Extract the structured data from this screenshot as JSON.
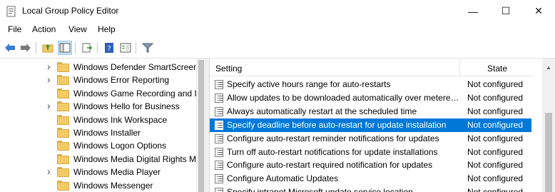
{
  "window": {
    "title": "Local Group Policy Editor",
    "minimize_glyph": "—",
    "maximize_glyph": "☐",
    "close_glyph": "✕"
  },
  "menu": [
    "File",
    "Action",
    "View",
    "Help"
  ],
  "toolbar": [
    "back-icon",
    "forward-icon",
    "up-folder-icon",
    "show-hide-tree-icon",
    "export-list-icon",
    "help-icon",
    "extended-view-icon",
    "filter-icon"
  ],
  "tree": {
    "items": [
      {
        "label": "Windows Defender SmartScreen",
        "expandable": true
      },
      {
        "label": "Windows Error Reporting",
        "expandable": true
      },
      {
        "label": "Windows Game Recording and I",
        "expandable": false
      },
      {
        "label": "Windows Hello for Business",
        "expandable": true
      },
      {
        "label": "Windows Ink Workspace",
        "expandable": false
      },
      {
        "label": "Windows Installer",
        "expandable": false
      },
      {
        "label": "Windows Logon Options",
        "expandable": false
      },
      {
        "label": "Windows Media Digital Rights M",
        "expandable": false
      },
      {
        "label": "Windows Media Player",
        "expandable": true
      },
      {
        "label": "Windows Messenger",
        "expandable": false
      }
    ]
  },
  "list": {
    "columns": {
      "setting": "Setting",
      "state": "State"
    },
    "rows": [
      {
        "name": "Specify active hours range for auto-restarts",
        "state": "Not configured",
        "selected": false
      },
      {
        "name": "Allow updates to be downloaded automatically over metered connections",
        "state": "Not configured",
        "selected": false
      },
      {
        "name": "Always automatically restart at the scheduled time",
        "state": "Not configured",
        "selected": false
      },
      {
        "name": "Specify deadline before auto-restart for update installation",
        "state": "Not configured",
        "selected": true
      },
      {
        "name": "Configure auto-restart reminder notifications for updates",
        "state": "Not configured",
        "selected": false
      },
      {
        "name": "Turn off auto-restart notifications for update installations",
        "state": "Not configured",
        "selected": false
      },
      {
        "name": "Configure auto-restart required notification for updates",
        "state": "Not configured",
        "selected": false
      },
      {
        "name": "Configure Automatic Updates",
        "state": "Not configured",
        "selected": false
      },
      {
        "name": "Specify intranet Microsoft update service location",
        "state": "Not configured",
        "selected": false
      }
    ]
  },
  "colors": {
    "selection": "#0078d7",
    "folder": "#f2cb67"
  }
}
